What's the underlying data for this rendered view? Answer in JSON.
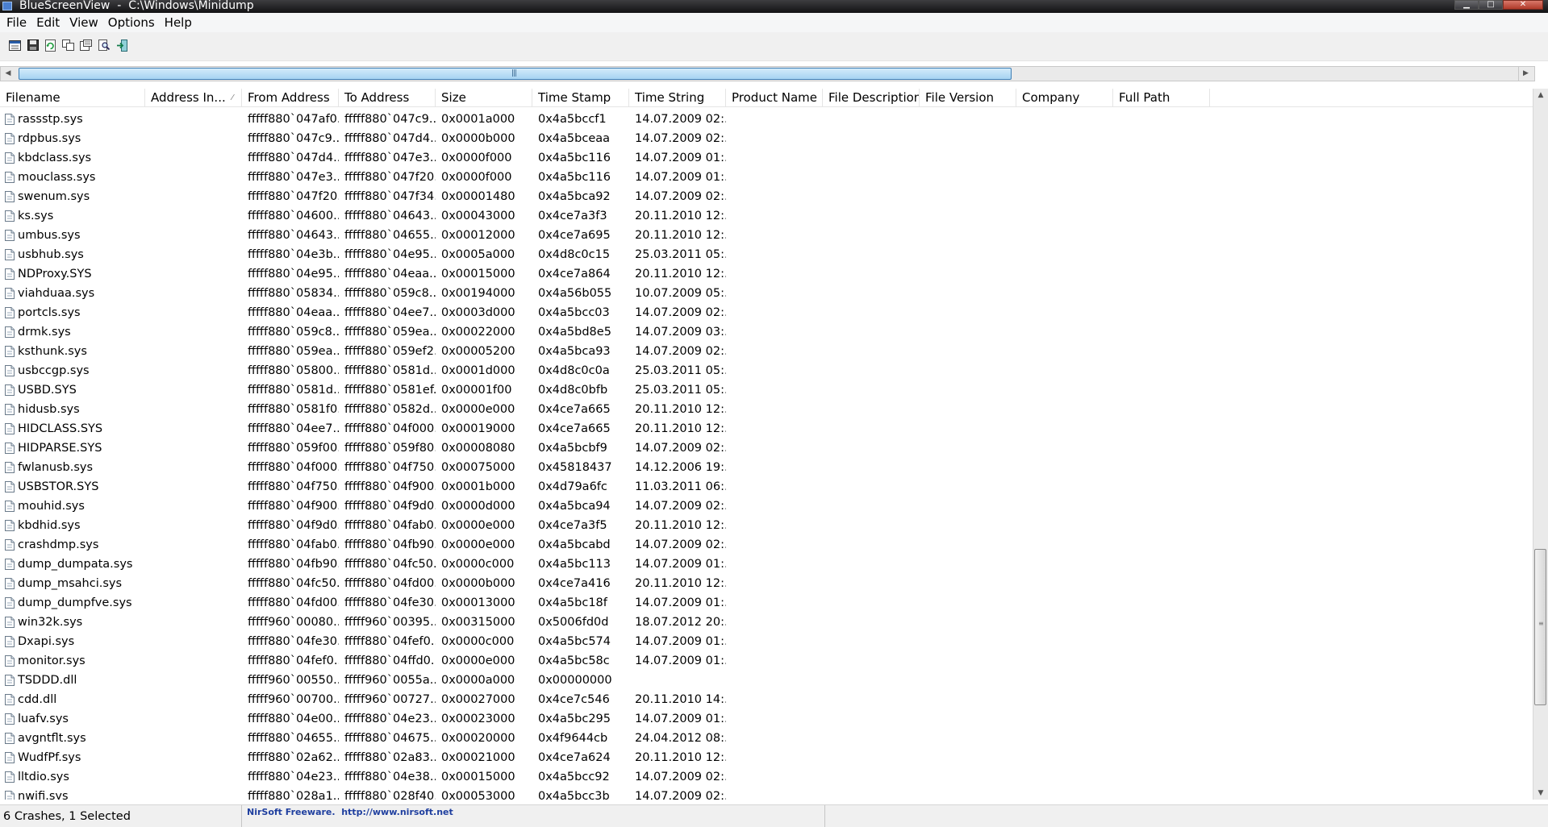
{
  "window": {
    "title": "BlueScreenView  -  C:\\Windows\\Minidump",
    "minimize_glyph": "▁",
    "maximize_glyph": "□",
    "close_glyph": "✕"
  },
  "menu": [
    "File",
    "Edit",
    "View",
    "Options",
    "Help"
  ],
  "toolbar": {
    "icons": [
      "html-report-icon",
      "save-icon",
      "refresh-icon",
      "copy-icon",
      "properties-icon",
      "find-icon",
      "exit-icon"
    ]
  },
  "hscroll": {
    "left_glyph": "◀",
    "right_glyph": "▶",
    "grip_glyph": "|||"
  },
  "vscroll": {
    "up_glyph": "▲",
    "down_glyph": "▼",
    "grip_glyph": "—<br>—<br>—"
  },
  "table": {
    "columns": [
      "Filename",
      "Address In...",
      "From Address",
      "To Address",
      "Size",
      "Time Stamp",
      "Time String",
      "Product Name",
      "File Description",
      "File Version",
      "Company",
      "Full Path"
    ],
    "sort_glyph": "⁄",
    "rows": [
      [
        "rassstp.sys",
        "",
        "fffff880`047af0...",
        "fffff880`047c9...",
        "0x0001a000",
        "0x4a5bccf1",
        "14.07.2009 02:..."
      ],
      [
        "rdpbus.sys",
        "",
        "fffff880`047c9...",
        "fffff880`047d4...",
        "0x0000b000",
        "0x4a5bceaa",
        "14.07.2009 02:..."
      ],
      [
        "kbdclass.sys",
        "",
        "fffff880`047d4...",
        "fffff880`047e3...",
        "0x0000f000",
        "0x4a5bc116",
        "14.07.2009 01:..."
      ],
      [
        "mouclass.sys",
        "",
        "fffff880`047e3...",
        "fffff880`047f20...",
        "0x0000f000",
        "0x4a5bc116",
        "14.07.2009 01:..."
      ],
      [
        "swenum.sys",
        "",
        "fffff880`047f20...",
        "fffff880`047f34...",
        "0x00001480",
        "0x4a5bca92",
        "14.07.2009 02:..."
      ],
      [
        "ks.sys",
        "",
        "fffff880`04600...",
        "fffff880`04643...",
        "0x00043000",
        "0x4ce7a3f3",
        "20.11.2010 12:..."
      ],
      [
        "umbus.sys",
        "",
        "fffff880`04643...",
        "fffff880`04655...",
        "0x00012000",
        "0x4ce7a695",
        "20.11.2010 12:..."
      ],
      [
        "usbhub.sys",
        "",
        "fffff880`04e3b...",
        "fffff880`04e95...",
        "0x0005a000",
        "0x4d8c0c15",
        "25.03.2011 05:..."
      ],
      [
        "NDProxy.SYS",
        "",
        "fffff880`04e95...",
        "fffff880`04eaa...",
        "0x00015000",
        "0x4ce7a864",
        "20.11.2010 12:..."
      ],
      [
        "viahduaa.sys",
        "",
        "fffff880`05834...",
        "fffff880`059c8...",
        "0x00194000",
        "0x4a56b055",
        "10.07.2009 05:..."
      ],
      [
        "portcls.sys",
        "",
        "fffff880`04eaa...",
        "fffff880`04ee7...",
        "0x0003d000",
        "0x4a5bcc03",
        "14.07.2009 02:..."
      ],
      [
        "drmk.sys",
        "",
        "fffff880`059c8...",
        "fffff880`059ea...",
        "0x00022000",
        "0x4a5bd8e5",
        "14.07.2009 03:..."
      ],
      [
        "ksthunk.sys",
        "",
        "fffff880`059ea...",
        "fffff880`059ef2...",
        "0x00005200",
        "0x4a5bca93",
        "14.07.2009 02:..."
      ],
      [
        "usbccgp.sys",
        "",
        "fffff880`05800...",
        "fffff880`0581d...",
        "0x0001d000",
        "0x4d8c0c0a",
        "25.03.2011 05:..."
      ],
      [
        "USBD.SYS",
        "",
        "fffff880`0581d...",
        "fffff880`0581ef...",
        "0x00001f00",
        "0x4d8c0bfb",
        "25.03.2011 05:..."
      ],
      [
        "hidusb.sys",
        "",
        "fffff880`0581f0...",
        "fffff880`0582d...",
        "0x0000e000",
        "0x4ce7a665",
        "20.11.2010 12:..."
      ],
      [
        "HIDCLASS.SYS",
        "",
        "fffff880`04ee7...",
        "fffff880`04f000...",
        "0x00019000",
        "0x4ce7a665",
        "20.11.2010 12:..."
      ],
      [
        "HIDPARSE.SYS",
        "",
        "fffff880`059f00...",
        "fffff880`059f80...",
        "0x00008080",
        "0x4a5bcbf9",
        "14.07.2009 02:..."
      ],
      [
        "fwlanusb.sys",
        "",
        "fffff880`04f000...",
        "fffff880`04f750...",
        "0x00075000",
        "0x45818437",
        "14.12.2006 19:..."
      ],
      [
        "USBSTOR.SYS",
        "",
        "fffff880`04f750...",
        "fffff880`04f900...",
        "0x0001b000",
        "0x4d79a6fc",
        "11.03.2011 06:..."
      ],
      [
        "mouhid.sys",
        "",
        "fffff880`04f900...",
        "fffff880`04f9d0...",
        "0x0000d000",
        "0x4a5bca94",
        "14.07.2009 02:..."
      ],
      [
        "kbdhid.sys",
        "",
        "fffff880`04f9d0...",
        "fffff880`04fab0...",
        "0x0000e000",
        "0x4ce7a3f5",
        "20.11.2010 12:..."
      ],
      [
        "crashdmp.sys",
        "",
        "fffff880`04fab0...",
        "fffff880`04fb90...",
        "0x0000e000",
        "0x4a5bcabd",
        "14.07.2009 02:..."
      ],
      [
        "dump_dumpata.sys",
        "",
        "fffff880`04fb90...",
        "fffff880`04fc50...",
        "0x0000c000",
        "0x4a5bc113",
        "14.07.2009 01:..."
      ],
      [
        "dump_msahci.sys",
        "",
        "fffff880`04fc50...",
        "fffff880`04fd00...",
        "0x0000b000",
        "0x4ce7a416",
        "20.11.2010 12:..."
      ],
      [
        "dump_dumpfve.sys",
        "",
        "fffff880`04fd00...",
        "fffff880`04fe30...",
        "0x00013000",
        "0x4a5bc18f",
        "14.07.2009 01:..."
      ],
      [
        "win32k.sys",
        "",
        "fffff960`00080...",
        "fffff960`00395...",
        "0x00315000",
        "0x5006fd0d",
        "18.07.2012 20:..."
      ],
      [
        "Dxapi.sys",
        "",
        "fffff880`04fe30...",
        "fffff880`04fef0...",
        "0x0000c000",
        "0x4a5bc574",
        "14.07.2009 01:..."
      ],
      [
        "monitor.sys",
        "",
        "fffff880`04fef0...",
        "fffff880`04ffd0...",
        "0x0000e000",
        "0x4a5bc58c",
        "14.07.2009 01:..."
      ],
      [
        "TSDDD.dll",
        "",
        "fffff960`00550...",
        "fffff960`0055a...",
        "0x0000a000",
        "0x00000000",
        ""
      ],
      [
        "cdd.dll",
        "",
        "fffff960`00700...",
        "fffff960`00727...",
        "0x00027000",
        "0x4ce7c546",
        "20.11.2010 14:..."
      ],
      [
        "luafv.sys",
        "",
        "fffff880`04e00...",
        "fffff880`04e23...",
        "0x00023000",
        "0x4a5bc295",
        "14.07.2009 01:..."
      ],
      [
        "avgntflt.sys",
        "",
        "fffff880`04655...",
        "fffff880`04675...",
        "0x00020000",
        "0x4f9644cb",
        "24.04.2012 08:..."
      ],
      [
        "WudfPf.sys",
        "",
        "fffff880`02a62...",
        "fffff880`02a83...",
        "0x00021000",
        "0x4ce7a624",
        "20.11.2010 12:..."
      ],
      [
        "lltdio.sys",
        "",
        "fffff880`04e23...",
        "fffff880`04e38...",
        "0x00015000",
        "0x4a5bcc92",
        "14.07.2009 02:..."
      ],
      [
        "nwifi.sys",
        "",
        "fffff880`028a1...",
        "fffff880`028f40...",
        "0x00053000",
        "0x4a5bcc3b",
        "14.07.2009 02:..."
      ]
    ]
  },
  "status": {
    "count": "6 Crashes, 1 Selected",
    "credit": "NirSoft Freeware.  http://www.nirsoft.net"
  },
  "colors": {
    "credit_text": "#1f3f9f",
    "scroll_thumb": "#a6d3f2"
  }
}
